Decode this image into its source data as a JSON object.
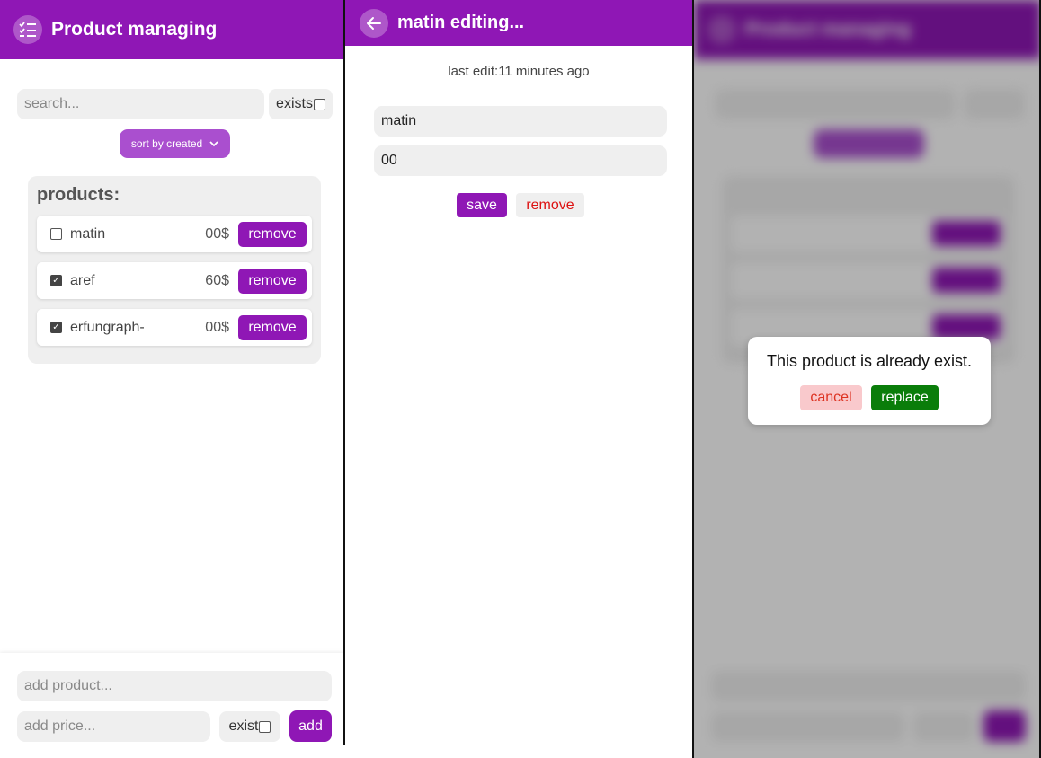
{
  "list_view": {
    "header": {
      "title": "Product managing",
      "icon": "checklist-icon"
    },
    "search": {
      "placeholder": "search...",
      "exists_label": "exists"
    },
    "sort": {
      "selected": "sort by created"
    },
    "products": {
      "title": "products:",
      "items": [
        {
          "name": "matin",
          "price": "00$",
          "checked": false,
          "remove_label": "remove"
        },
        {
          "name": "aref",
          "price": "60$",
          "checked": true,
          "remove_label": "remove"
        },
        {
          "name": "erfungraph-",
          "price": "00$",
          "checked": true,
          "remove_label": "remove"
        }
      ]
    },
    "add_form": {
      "product_placeholder": "add product...",
      "price_placeholder": "add price...",
      "exist_label": "exist",
      "add_label": "add"
    }
  },
  "edit_view": {
    "header": {
      "title": "matin editing...",
      "icon": "arrow-left-icon"
    },
    "last_edit": "last edit:11 minutes ago",
    "name_value": "matin",
    "price_value": "00",
    "save_label": "save",
    "remove_label": "remove"
  },
  "modal": {
    "message": "This product is already exist.",
    "cancel_label": "cancel",
    "replace_label": "replace"
  },
  "colors": {
    "primary": "#8f17b5",
    "input_bg": "#efefef",
    "danger": "#dd1111",
    "cancel_bg": "#f9c9cc",
    "replace_bg": "#0a7d0a"
  }
}
